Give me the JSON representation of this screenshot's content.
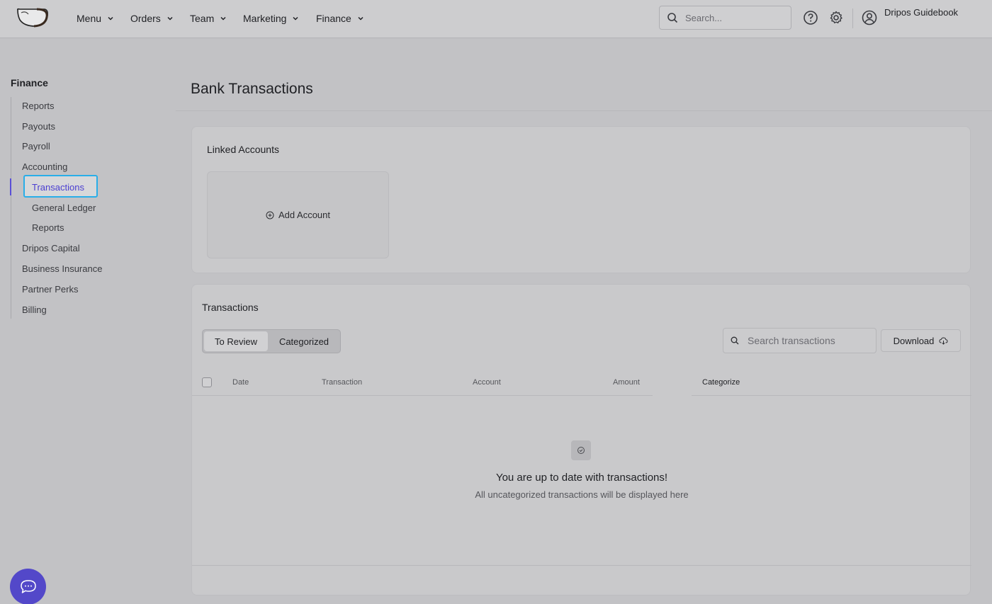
{
  "topnav": {
    "items": [
      {
        "label": "Menu"
      },
      {
        "label": "Orders"
      },
      {
        "label": "Team"
      },
      {
        "label": "Marketing"
      },
      {
        "label": "Finance"
      }
    ],
    "search_placeholder": "Search...",
    "user_name": "Dripos Guidebook"
  },
  "sidebar": {
    "title": "Finance",
    "items": [
      {
        "label": "Reports"
      },
      {
        "label": "Payouts"
      },
      {
        "label": "Payroll"
      },
      {
        "label": "Accounting"
      },
      {
        "label": "Transactions"
      },
      {
        "label": "General Ledger"
      },
      {
        "label": "Reports"
      },
      {
        "label": "Dripos Capital"
      },
      {
        "label": "Business Insurance"
      },
      {
        "label": "Partner Perks"
      },
      {
        "label": "Billing"
      }
    ]
  },
  "main": {
    "page_title": "Bank Transactions",
    "linked_accounts": {
      "title": "Linked Accounts",
      "add_label": "Add Account"
    },
    "transactions": {
      "title": "Transactions",
      "tabs": [
        {
          "label": "To Review"
        },
        {
          "label": "Categorized"
        }
      ],
      "search_placeholder": "Search transactions",
      "download_label": "Download",
      "columns": [
        "Date",
        "Transaction",
        "Account",
        "Amount",
        "Categorize"
      ],
      "empty_title": "You are up to date with transactions!",
      "empty_subtitle": "All uncategorized transactions will be displayed here"
    }
  },
  "colors": {
    "accent": "#5348c9",
    "active_text": "#4b3fd1",
    "focus_outline": "#29aee8"
  }
}
